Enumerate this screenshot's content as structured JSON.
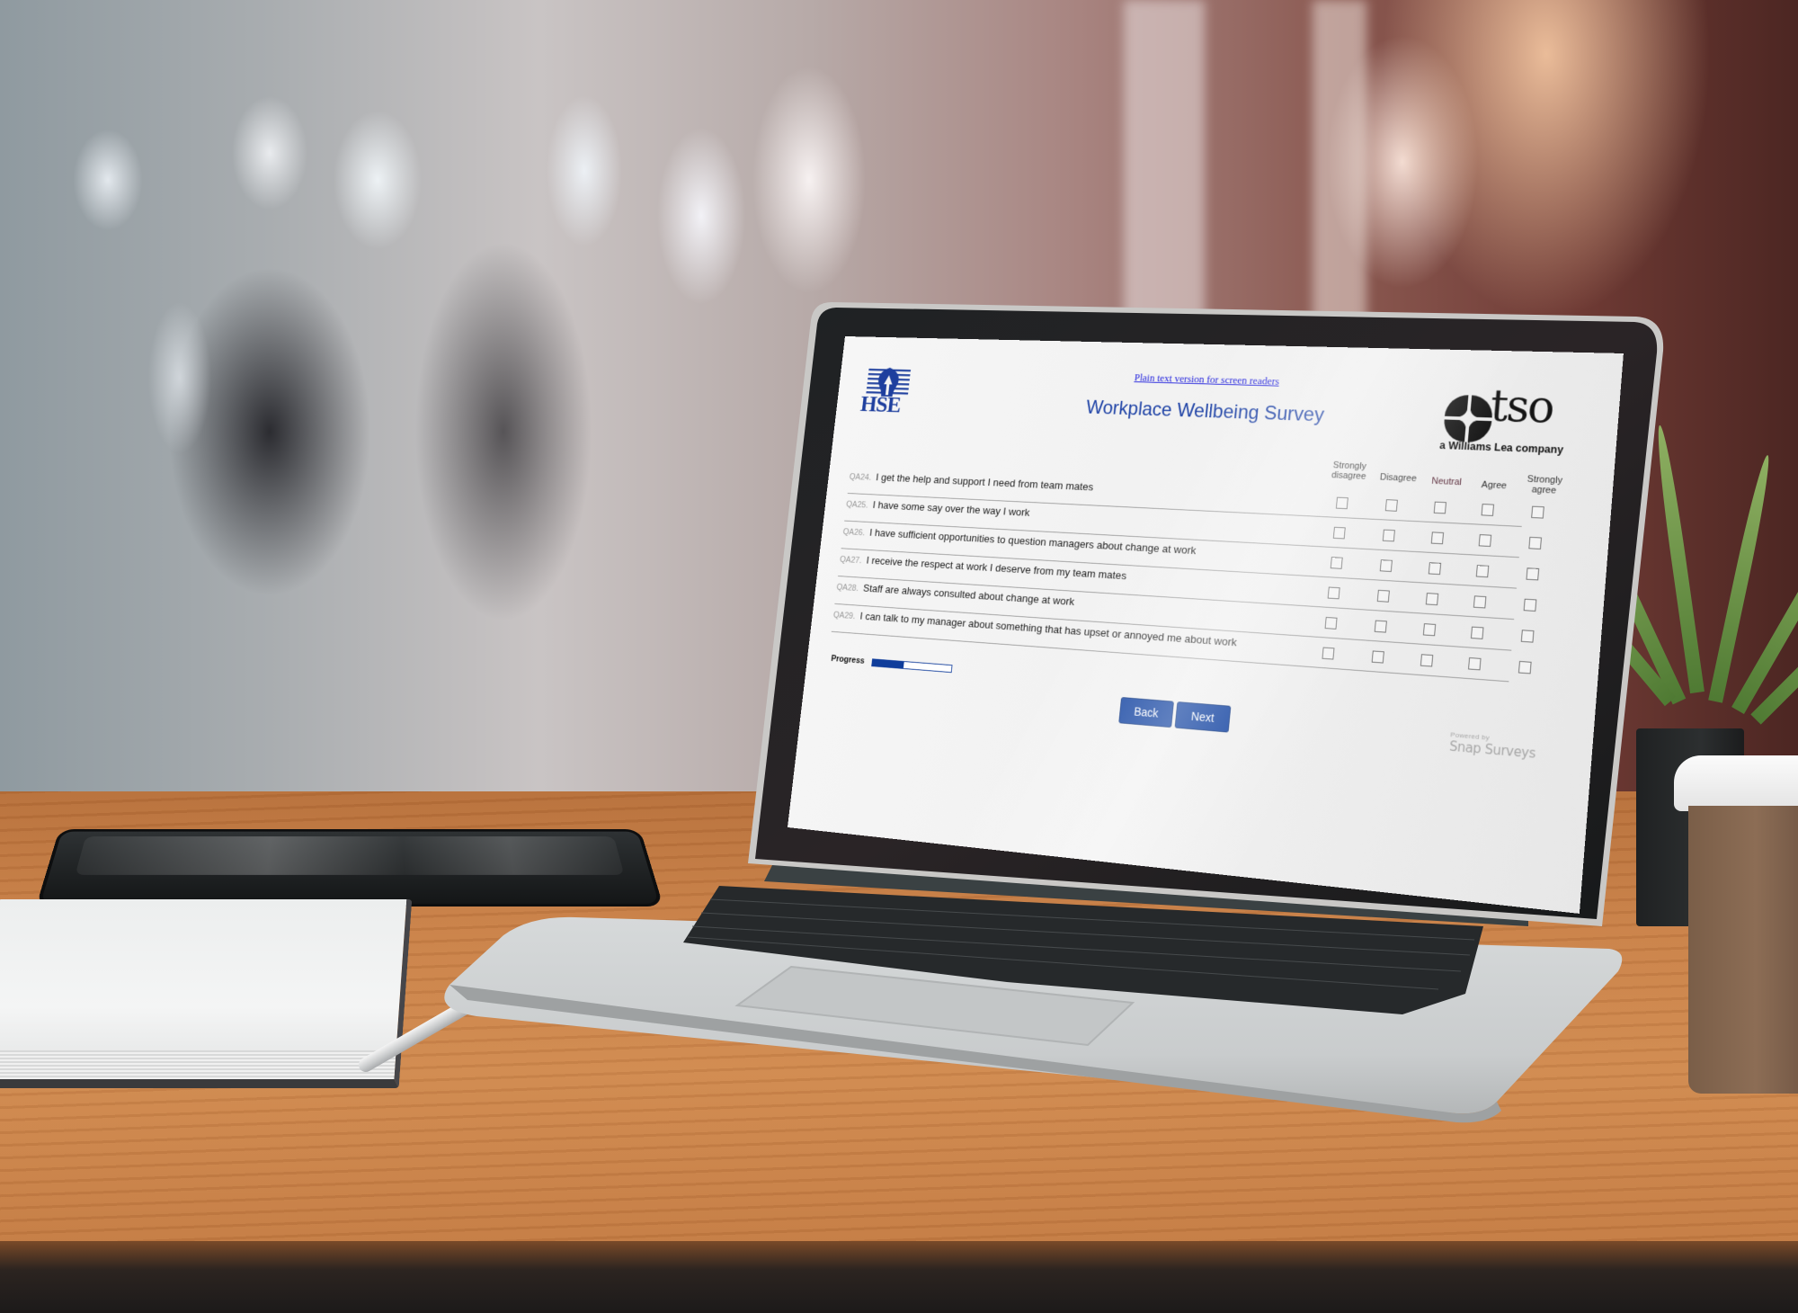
{
  "scene": {
    "description": "Laptop on a wooden desk displaying a web survey"
  },
  "survey": {
    "plain_text_link": "Plain text version for screen readers",
    "title": "Workplace Wellbeing Survey",
    "left_logo": {
      "icon": "hse-logo-icon",
      "text": "HSE"
    },
    "right_logo": {
      "icon": "tso-star-icon",
      "word": "tso",
      "subtitle": "a Williams Lea company"
    },
    "scale_headers": [
      "Strongly disagree",
      "Disagree",
      "Neutral",
      "Agree",
      "Strongly agree"
    ],
    "questions": [
      {
        "id": "QA24.",
        "text": "I get the help and support I need from team mates",
        "selected": null
      },
      {
        "id": "QA25.",
        "text": "I have some say over the way I work",
        "selected": null
      },
      {
        "id": "QA26.",
        "text": "I have sufficient opportunities to question managers about change at work",
        "selected": null
      },
      {
        "id": "QA27.",
        "text": "I receive the respect at work I deserve from my team mates",
        "selected": null
      },
      {
        "id": "QA28.",
        "text": "Staff are always consulted about change at work",
        "selected": null
      },
      {
        "id": "QA29.",
        "text": "I can talk to my manager about something that has upset or annoyed me about work",
        "selected": null
      }
    ],
    "progress": {
      "label": "Progress",
      "percent": 40
    },
    "buttons": {
      "back": "Back",
      "next": "Next"
    },
    "powered_by": {
      "prefix": "Powered by",
      "brand": "Snap Surveys"
    },
    "colors": {
      "brand_blue": "#0b3d9e",
      "title_blue": "#1f43a6",
      "link_blue": "#2222dd"
    }
  }
}
